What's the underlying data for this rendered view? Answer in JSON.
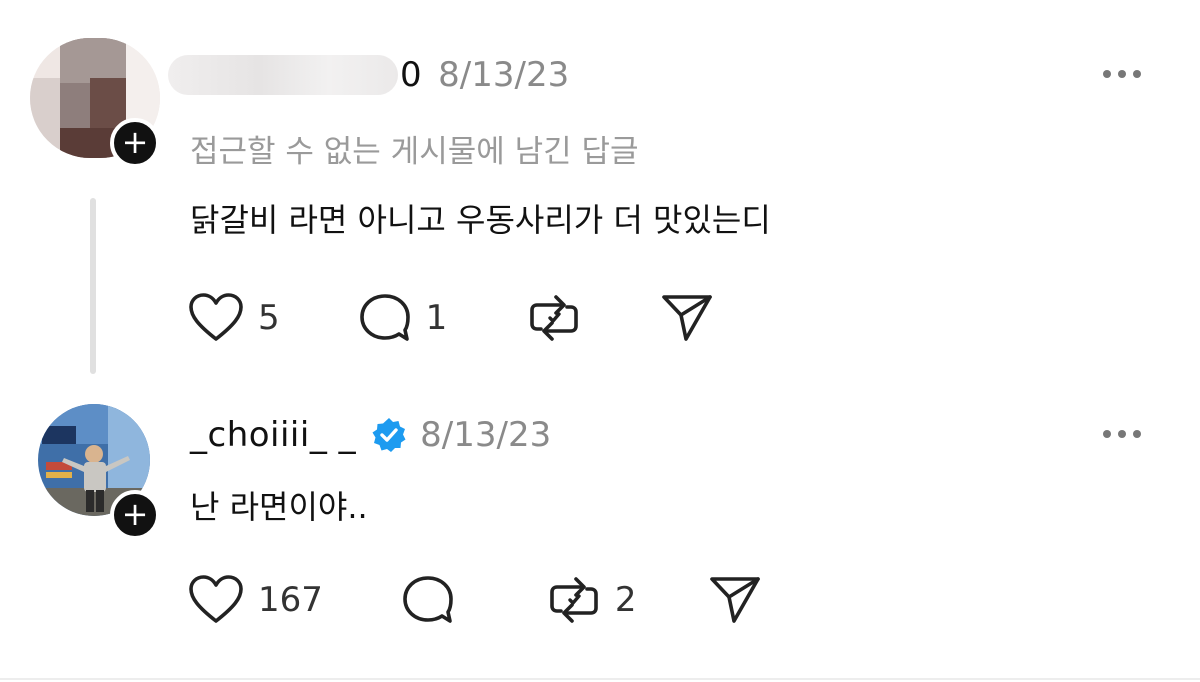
{
  "posts": [
    {
      "username": "0",
      "date": "8/13/23",
      "subtext": "접근할 수 없는 게시물에 남긴 답글",
      "text": "닭갈비 라면 아니고 우동사리가 더 맛있는디",
      "likes": "5",
      "replies": "1",
      "reposts": "",
      "follow_icon": "plus-icon",
      "more_icon": "more-horizontal-icon"
    },
    {
      "username": "_choiiii_ _",
      "date": "8/13/23",
      "verified": true,
      "text": "난 라면이야..",
      "likes": "167",
      "replies": "",
      "reposts": "2",
      "follow_icon": "plus-icon",
      "more_icon": "more-horizontal-icon"
    }
  ],
  "colors": {
    "verified_badge": "#1d9bf0",
    "text_primary": "#111111",
    "text_secondary": "#8a8a8a"
  }
}
